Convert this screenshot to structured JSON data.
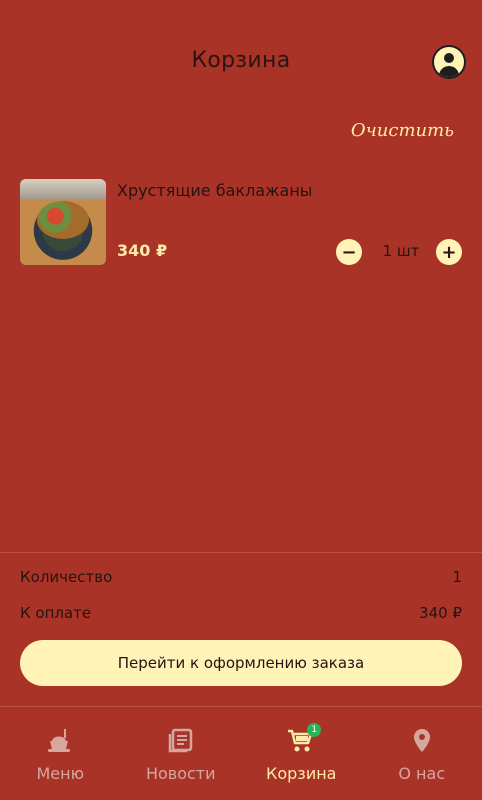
{
  "header": {
    "title": "Корзина",
    "account_icon": "account-circle-icon"
  },
  "actions": {
    "clear_label": "Очистить"
  },
  "cart_item": {
    "name": "Хрустящие баклажаны",
    "price": "340 ₽",
    "quantity": "1 шт",
    "thumbnail_icon": "food-thumbnail"
  },
  "summary": {
    "count_label": "Количество",
    "count_value": "1",
    "total_label": "К оплате",
    "total_value": "340 ₽"
  },
  "checkout": {
    "label": "Перейти к оформлению заказа"
  },
  "tabbar": {
    "items": [
      {
        "label": "Меню",
        "icon": "fastfood-icon"
      },
      {
        "label": "Новости",
        "icon": "news-icon"
      },
      {
        "label": "Корзина",
        "icon": "cart-icon",
        "badge": "1"
      },
      {
        "label": "О нас",
        "icon": "location-pin-icon"
      }
    ],
    "active_index": 2
  },
  "colors": {
    "background": "#aa3328",
    "accent": "#ffe9a8",
    "button_bg": "#fff3b8",
    "badge": "#2bb457"
  }
}
